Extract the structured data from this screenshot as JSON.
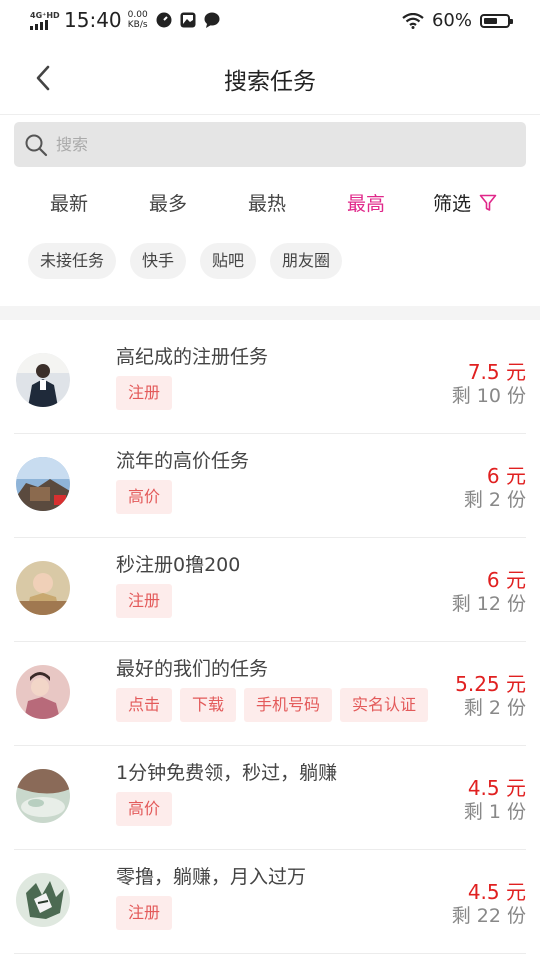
{
  "status_bar": {
    "network": "4G⁺HD",
    "time": "15:40",
    "speed_value": "0.00",
    "speed_unit": "KB/s",
    "battery_percent": "60%",
    "battery_level": 0.6
  },
  "header": {
    "title": "搜索任务"
  },
  "search": {
    "placeholder": "搜索"
  },
  "sort_tabs": [
    {
      "label": "最新",
      "active": false
    },
    {
      "label": "最多",
      "active": false
    },
    {
      "label": "最热",
      "active": false
    },
    {
      "label": "最高",
      "active": true
    }
  ],
  "filter": {
    "label": "筛选"
  },
  "category_tags": [
    "未接任务",
    "快手",
    "贴吧",
    "朋友圈"
  ],
  "tasks": [
    {
      "title": "高纪成的注册任务",
      "chips": [
        "注册"
      ],
      "price": "7.5 元",
      "remaining": "剩 10 份"
    },
    {
      "title": "流年的高价任务",
      "chips": [
        "高价"
      ],
      "price": "6 元",
      "remaining": "剩 2 份"
    },
    {
      "title": "秒注册0撸200",
      "chips": [
        "注册"
      ],
      "price": "6 元",
      "remaining": "剩 12 份"
    },
    {
      "title": "最好的我们的任务",
      "chips": [
        "点击",
        "下载",
        "手机号码",
        "实名认证"
      ],
      "price": "5.25 元",
      "remaining": "剩 2 份"
    },
    {
      "title": "1分钟免费领，秒过，躺赚",
      "chips": [
        "高价"
      ],
      "price": "4.5 元",
      "remaining": "剩 1 份"
    },
    {
      "title": "零撸，躺赚，月入过万",
      "chips": [
        "注册"
      ],
      "price": "4.5 元",
      "remaining": "剩 22 份"
    }
  ],
  "colors": {
    "accent": "#e0288a",
    "price": "#e02020",
    "chip_bg": "#fdeceb",
    "chip_text": "#e35a5a"
  }
}
